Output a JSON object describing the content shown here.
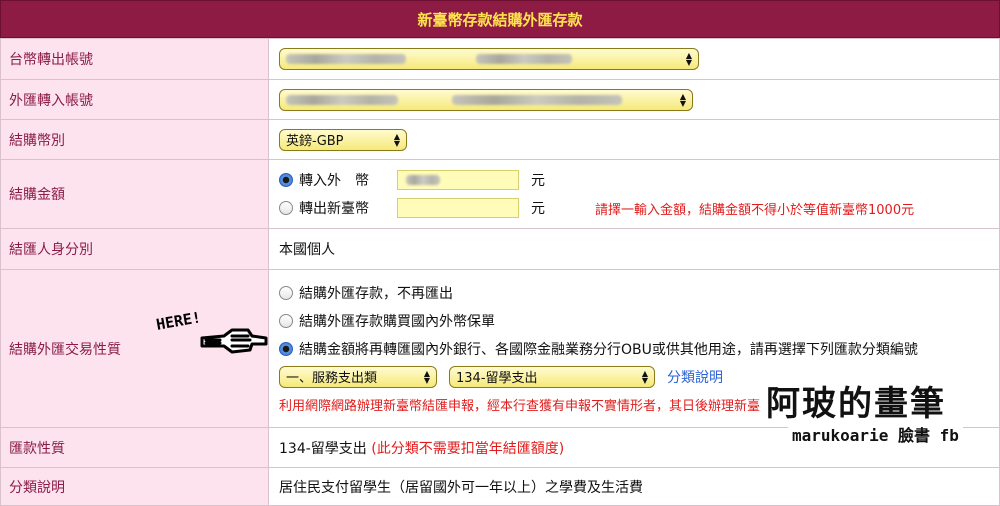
{
  "page": {
    "title": "新臺幣存款結購外匯存款"
  },
  "rows": {
    "twd_account": {
      "label": "台幣轉出帳號"
    },
    "fx_account": {
      "label": "外匯轉入帳號"
    },
    "currency": {
      "label": "結購幣別",
      "selected": "英鎊-GBP"
    },
    "amount": {
      "label": "結購金額",
      "option_in": "轉入外　幣",
      "option_out": "轉出新臺幣",
      "unit": "元",
      "hint": "請擇一輸入金額，結購金額不得小於等值新臺幣1000元"
    },
    "identity": {
      "label": "結匯人身分別",
      "value": "本國個人"
    },
    "purpose": {
      "label": "結購外匯交易性質",
      "options": [
        "結購外匯存款，不再匯出",
        "結購外匯存款購買國內外幣保單",
        "結購金額將再轉匯國內外銀行、各國際金融業務分行OBU或供其他用途，請再選擇下列匯款分類編號"
      ],
      "category_main": "一、服務支出類",
      "category_sub": "134-留學支出",
      "category_link": "分類說明",
      "warning": "利用網際網路辦理新臺幣結匯申報，經本行查獲有申報不實情形者，其日後辦理新臺幣結匯申報事務，需至營業櫃"
    },
    "remit_nature": {
      "label": "匯款性質",
      "value": "134-留學支出",
      "note": "(此分類不需要扣當年結匯額度)"
    },
    "category_desc": {
      "label": "分類說明",
      "value": "居住民支付留學生（居留國外可一年以上）之學費及生活費"
    }
  },
  "annotation": {
    "here_text": "HERE!"
  },
  "watermark": {
    "title": "阿玻的畫筆",
    "handle": "marukoarie 臉書 fb"
  },
  "colors": {
    "title_bg": "#8e1b43",
    "title_text": "#ffe34c",
    "label_bg": "#fde3ee",
    "label_text": "#8a1d46",
    "warning": "#e21c1c",
    "link": "#2b63d6"
  }
}
